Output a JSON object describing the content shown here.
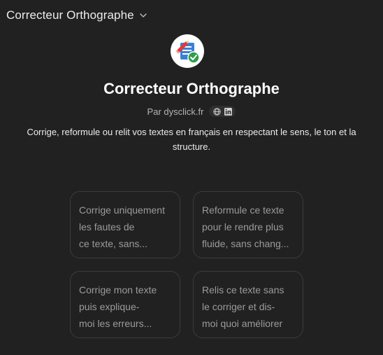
{
  "header": {
    "title": "Correcteur Orthographe"
  },
  "gpt": {
    "name": "Correcteur Orthographe",
    "author_label": "Par dysclick.fr",
    "description": "Corrige, reformule ou relit vos textes en français en respectant le sens, le ton et la structure."
  },
  "icons": {
    "header_chevron": "chevron-down-icon",
    "avatar": "pen-document-check-icon",
    "website": "globe-icon",
    "linkedin": "linkedin-icon"
  },
  "colors": {
    "background": "#212121",
    "card_border": "#3c3c3c",
    "card_text": "#9b9b9b",
    "check_green": "#2e9e4a"
  },
  "starters": [
    {
      "lines": [
        "Corrige uniquement",
        "les fautes de",
        "ce texte, sans..."
      ]
    },
    {
      "lines": [
        "Reformule ce texte",
        "pour le rendre plus",
        "fluide, sans chang..."
      ]
    },
    {
      "lines": [
        "Corrige mon texte",
        "puis explique-",
        "moi les erreurs..."
      ]
    },
    {
      "lines": [
        "Relis ce texte sans",
        "le corriger et dis-",
        "moi quoi améliorer"
      ]
    }
  ]
}
